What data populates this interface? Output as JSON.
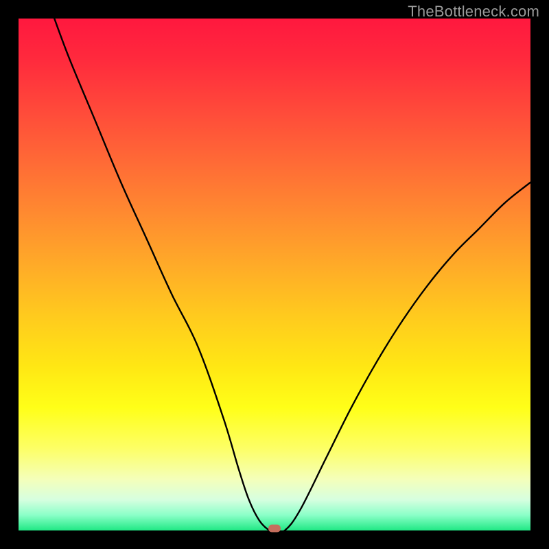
{
  "watermark": "TheBottleneck.com",
  "colors": {
    "frame": "#000000",
    "curve": "#000000",
    "marker": "#c56e5d",
    "gradient_top": "#ff183e",
    "gradient_bottom": "#20e884"
  },
  "chart_data": {
    "type": "line",
    "title": "",
    "xlabel": "",
    "ylabel": "",
    "xlim": [
      0,
      100
    ],
    "ylim": [
      0,
      100
    ],
    "x": [
      7,
      10,
      15,
      20,
      25,
      30,
      35,
      40,
      43,
      45,
      47,
      49,
      50,
      52,
      55,
      60,
      65,
      70,
      75,
      80,
      85,
      90,
      95,
      100
    ],
    "values": [
      100,
      92,
      80,
      68,
      57,
      46,
      36,
      22,
      12,
      6,
      2,
      0,
      0,
      0,
      4,
      14,
      24,
      33,
      41,
      48,
      54,
      59,
      64,
      68
    ],
    "marker": {
      "x": 50,
      "y": 0
    },
    "annotations": []
  }
}
